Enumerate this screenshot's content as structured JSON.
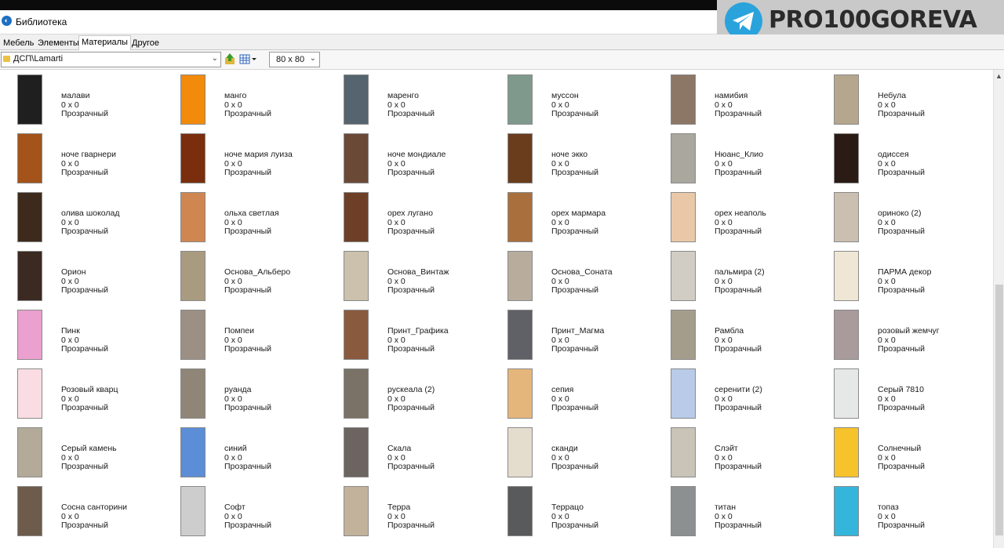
{
  "window": {
    "title": "Библиотека"
  },
  "watermark": {
    "text": "PRO100GOREVA"
  },
  "tabs": [
    {
      "label": "Мебель",
      "active": false
    },
    {
      "label": "Элементы",
      "active": false
    },
    {
      "label": "Материалы",
      "active": true
    },
    {
      "label": "Другое",
      "active": false
    }
  ],
  "toolbar": {
    "path": "ДСП\\Lamarti",
    "size": "80 x 80"
  },
  "materials": [
    {
      "name": "малави",
      "size": "0 x 0",
      "mode": "Прозрачный",
      "color": "#1f1f1f"
    },
    {
      "name": "манго",
      "size": "0 x 0",
      "mode": "Прозрачный",
      "color": "#f28a0c"
    },
    {
      "name": "маренго",
      "size": "0 x 0",
      "mode": "Прозрачный",
      "color": "#55646e"
    },
    {
      "name": "муссон",
      "size": "0 x 0",
      "mode": "Прозрачный",
      "color": "#7f9a8c"
    },
    {
      "name": "намибия",
      "size": "0 x 0",
      "mode": "Прозрачный",
      "color": "#8c7766"
    },
    {
      "name": "Небула",
      "size": "0 x 0",
      "mode": "Прозрачный",
      "color": "#b5a68e"
    },
    {
      "name": "ноче гварнери",
      "size": "0 x 0",
      "mode": "Прозрачный",
      "color": "#a4531a"
    },
    {
      "name": "ноче мария луиза",
      "size": "0 x 0",
      "mode": "Прозрачный",
      "color": "#7a2e0d"
    },
    {
      "name": "ноче мондиале",
      "size": "0 x 0",
      "mode": "Прозрачный",
      "color": "#6b4937"
    },
    {
      "name": "ноче экко",
      "size": "0 x 0",
      "mode": "Прозрачный",
      "color": "#6a3d1d"
    },
    {
      "name": "Нюанс_Клио",
      "size": "0 x 0",
      "mode": "Прозрачный",
      "color": "#a9a79e"
    },
    {
      "name": "одиссея",
      "size": "0 x 0",
      "mode": "Прозрачный",
      "color": "#2a1b14"
    },
    {
      "name": "олива шоколад",
      "size": "0 x 0",
      "mode": "Прозрачный",
      "color": "#3e2a1c"
    },
    {
      "name": "ольха светлая",
      "size": "0 x 0",
      "mode": "Прозрачный",
      "color": "#d08650"
    },
    {
      "name": "орех лугано",
      "size": "0 x 0",
      "mode": "Прозрачный",
      "color": "#6e3f27"
    },
    {
      "name": "орех мармара",
      "size": "0 x 0",
      "mode": "Прозрачный",
      "color": "#a9703e"
    },
    {
      "name": "орех неаполь",
      "size": "0 x 0",
      "mode": "Прозрачный",
      "color": "#e9c8a8"
    },
    {
      "name": "ориноко (2)",
      "size": "0 x 0",
      "mode": "Прозрачный",
      "color": "#cbbfb1"
    },
    {
      "name": "Орион",
      "size": "0 x 0",
      "mode": "Прозрачный",
      "color": "#3b2a22"
    },
    {
      "name": "Основа_Альберо",
      "size": "0 x 0",
      "mode": "Прозрачный",
      "color": "#a99b80"
    },
    {
      "name": "Основа_Винтаж",
      "size": "0 x 0",
      "mode": "Прозрачный",
      "color": "#ccc1ad"
    },
    {
      "name": "Основа_Соната",
      "size": "0 x 0",
      "mode": "Прозрачный",
      "color": "#b8ad9d"
    },
    {
      "name": "пальмира (2)",
      "size": "0 x 0",
      "mode": "Прозрачный",
      "color": "#d2cdc4"
    },
    {
      "name": "ПАРМА декор",
      "size": "0 x 0",
      "mode": "Прозрачный",
      "color": "#efe6d5"
    },
    {
      "name": "Пинк",
      "size": "0 x 0",
      "mode": "Прозрачный",
      "color": "#eba0cf"
    },
    {
      "name": "Помпеи",
      "size": "0 x 0",
      "mode": "Прозрачный",
      "color": "#9c8f83"
    },
    {
      "name": "Принт_Графика",
      "size": "0 x 0",
      "mode": "Прозрачный",
      "color": "#8a5a3e"
    },
    {
      "name": "Принт_Магма",
      "size": "0 x 0",
      "mode": "Прозрачный",
      "color": "#5f6166"
    },
    {
      "name": "Рамбла",
      "size": "0 x 0",
      "mode": "Прозрачный",
      "color": "#a59d8c"
    },
    {
      "name": "розовый жемчуг",
      "size": "0 x 0",
      "mode": "Прозрачный",
      "color": "#a99a9c"
    },
    {
      "name": "Розовый кварц",
      "size": "0 x 0",
      "mode": "Прозрачный",
      "color": "#f9dde2"
    },
    {
      "name": "руанда",
      "size": "0 x 0",
      "mode": "Прозрачный",
      "color": "#908677"
    },
    {
      "name": "рускеала (2)",
      "size": "0 x 0",
      "mode": "Прозрачный",
      "color": "#7a7266"
    },
    {
      "name": "сепия",
      "size": "0 x 0",
      "mode": "Прозрачный",
      "color": "#e5b67c"
    },
    {
      "name": "серенити (2)",
      "size": "0 x 0",
      "mode": "Прозрачный",
      "color": "#b9cbe9"
    },
    {
      "name": "Серый 7810",
      "size": "0 x 0",
      "mode": "Прозрачный",
      "color": "#e6e8e8"
    },
    {
      "name": "Серый камень",
      "size": "0 x 0",
      "mode": "Прозрачный",
      "color": "#b3aa9a"
    },
    {
      "name": "синий",
      "size": "0 x 0",
      "mode": "Прозрачный",
      "color": "#5b8ed6"
    },
    {
      "name": "Скала",
      "size": "0 x 0",
      "mode": "Прозрачный",
      "color": "#6c6460"
    },
    {
      "name": "сканди",
      "size": "0 x 0",
      "mode": "Прозрачный",
      "color": "#e4dccd"
    },
    {
      "name": "Слэйт",
      "size": "0 x 0",
      "mode": "Прозрачный",
      "color": "#c9c3b8"
    },
    {
      "name": "Солнечный",
      "size": "0 x 0",
      "mode": "Прозрачный",
      "color": "#f6c32c"
    },
    {
      "name": "Сосна санторини",
      "size": "0 x 0",
      "mode": "Прозрачный",
      "color": "#6d5c4c"
    },
    {
      "name": "Софт",
      "size": "0 x 0",
      "mode": "Прозрачный",
      "color": "#cdcdcd"
    },
    {
      "name": "Терра",
      "size": "0 x 0",
      "mode": "Прозрачный",
      "color": "#c2b29b"
    },
    {
      "name": "Террацо",
      "size": "0 x 0",
      "mode": "Прозрачный",
      "color": "#595a5c"
    },
    {
      "name": "титан",
      "size": "0 x 0",
      "mode": "Прозрачный",
      "color": "#8c9090"
    },
    {
      "name": "топаз",
      "size": "0 x 0",
      "mode": "Прозрачный",
      "color": "#33b5dc"
    }
  ]
}
